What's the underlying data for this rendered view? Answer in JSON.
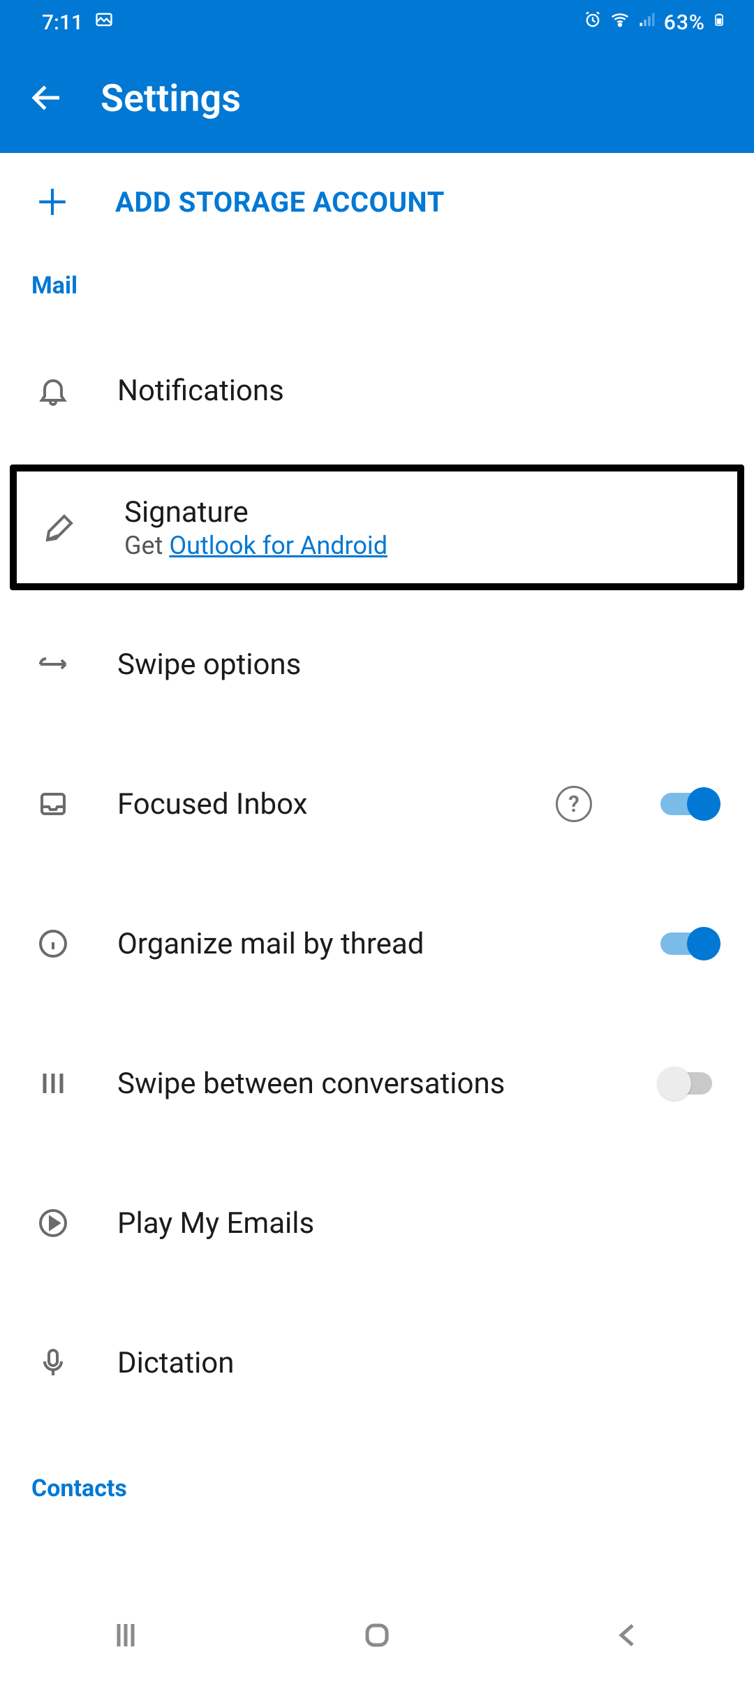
{
  "status": {
    "time": "7:11",
    "battery": "63%"
  },
  "header": {
    "title": "Settings"
  },
  "add_storage": {
    "label": "ADD STORAGE ACCOUNT"
  },
  "sections": {
    "mail": "Mail",
    "contacts": "Contacts"
  },
  "items": {
    "notifications": {
      "title": "Notifications"
    },
    "signature": {
      "title": "Signature",
      "sub_prefix": "Get ",
      "sub_link": "Outlook for Android"
    },
    "swipe_options": {
      "title": "Swipe options"
    },
    "focused_inbox": {
      "title": "Focused Inbox",
      "on": true
    },
    "organize_thread": {
      "title": "Organize mail by thread",
      "on": true
    },
    "swipe_convo": {
      "title": "Swipe between conversations",
      "on": false
    },
    "play_emails": {
      "title": "Play My Emails"
    },
    "dictation": {
      "title": "Dictation"
    }
  }
}
